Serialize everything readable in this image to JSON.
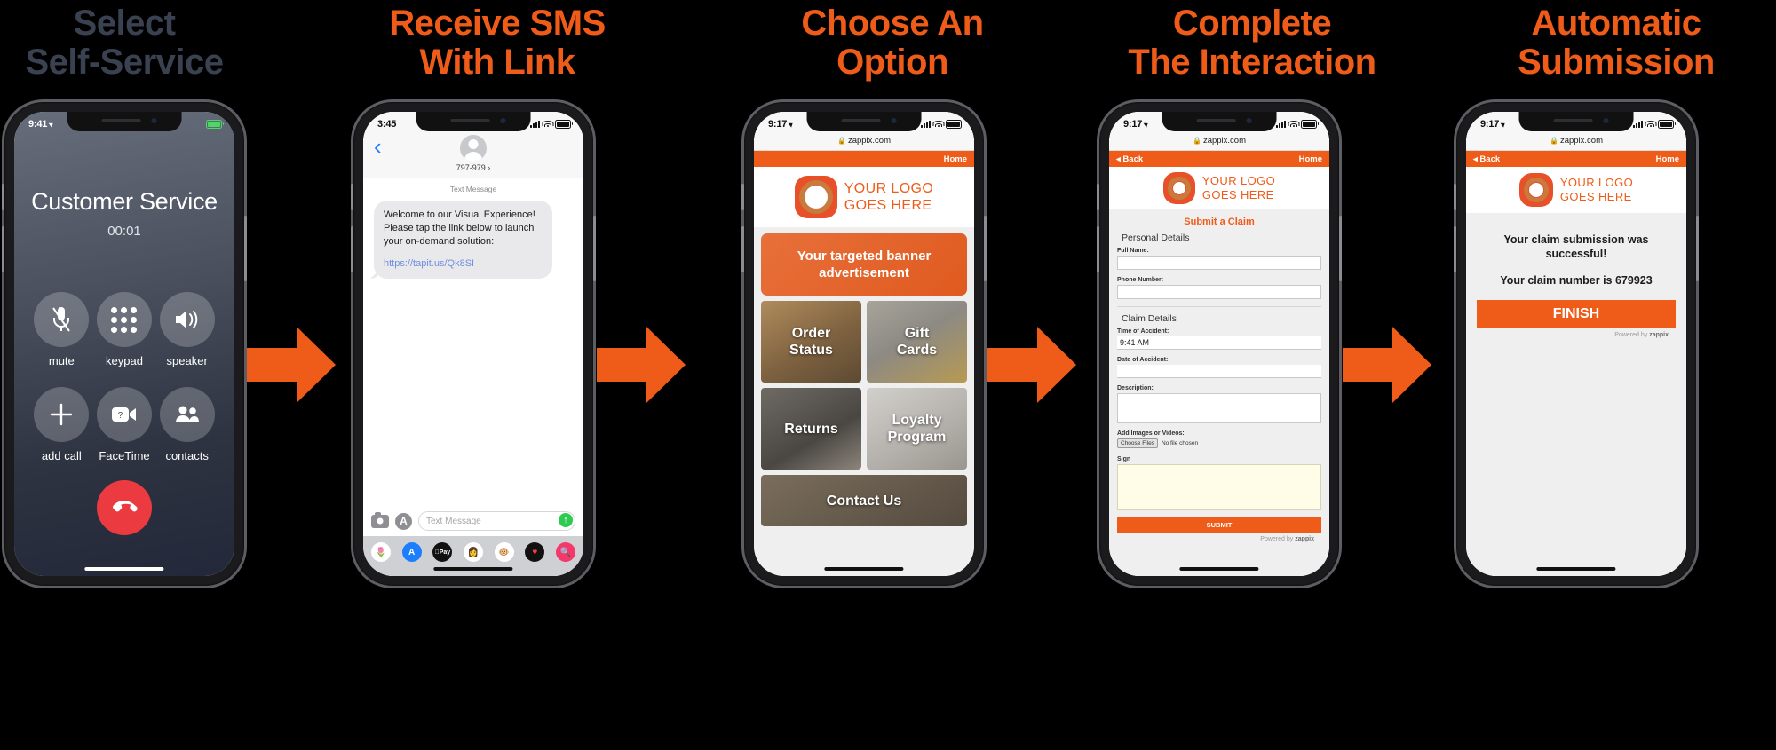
{
  "steps": [
    {
      "title_line1": "Select",
      "title_line2": "Self-Service",
      "color": "#3a4150"
    },
    {
      "title_line1": "Receive SMS",
      "title_line2": "With Link",
      "color": "#ef5c19"
    },
    {
      "title_line1": "Choose An",
      "title_line2": "Option",
      "color": "#ef5c19"
    },
    {
      "title_line1": "Complete",
      "title_line2": "The Interaction",
      "color": "#ef5c19"
    },
    {
      "title_line1": "Automatic",
      "title_line2": "Submission",
      "color": "#ef5c19"
    }
  ],
  "phone_call": {
    "status_time": "9:41",
    "caller_name": "Customer Service",
    "call_duration": "00:01",
    "buttons": [
      {
        "label": "mute",
        "icon": "microphone-muted-icon"
      },
      {
        "label": "keypad",
        "icon": "keypad-icon"
      },
      {
        "label": "speaker",
        "icon": "speaker-icon"
      },
      {
        "label": "add call",
        "icon": "plus-icon"
      },
      {
        "label": "FaceTime",
        "icon": "video-camera-icon"
      },
      {
        "label": "contacts",
        "icon": "contacts-icon"
      }
    ],
    "end_call_icon": "end-call-icon"
  },
  "phone_sms": {
    "status_time": "3:45",
    "contact_number": "797-979",
    "timestamp_label": "Text Message",
    "message_body": "Welcome to our Visual Experience! Please tap the link below to launch your on-demand solution:",
    "message_link": "https://tapit.us/Qk8SI",
    "input_placeholder": "Text Message",
    "send_icon": "send-arrow-icon",
    "dock_apps": [
      "photos-app-icon",
      "app-store-icon",
      "apple-pay-icon",
      "memoji-icon",
      "animoji-icon",
      "music-app-icon",
      "images-search-icon"
    ]
  },
  "phone_menu": {
    "status_time": "9:17",
    "url": "zappix.com",
    "nav_home": "Home",
    "logo_line1": "YOUR LOGO",
    "logo_line2": "GOES HERE",
    "banner_line1": "Your targeted banner",
    "banner_line2": "advertisement",
    "tiles": [
      {
        "line1": "Order",
        "line2": "Status"
      },
      {
        "line1": "Gift",
        "line2": "Cards"
      },
      {
        "line1": "Returns",
        "line2": ""
      },
      {
        "line1": "Loyalty",
        "line2": "Program"
      },
      {
        "line1": "Contact Us",
        "line2": ""
      }
    ]
  },
  "phone_form": {
    "status_time": "9:17",
    "url": "zappix.com",
    "nav_back": "Back",
    "nav_home": "Home",
    "logo_line1": "YOUR LOGO",
    "logo_line2": "GOES HERE",
    "form_title": "Submit a Claim",
    "section_personal": "Personal Details",
    "label_fullname": "Full Name:",
    "value_fullname": "",
    "label_phone": "Phone Number:",
    "value_phone": "",
    "section_claim": "Claim Details",
    "label_time": "Time of Accident:",
    "value_time": "9:41 AM",
    "label_date": "Date of Accident:",
    "value_date": "",
    "label_description": "Description:",
    "value_description": "",
    "label_media": "Add Images or Videos:",
    "file_button": "Choose Files",
    "file_status": "No file chosen",
    "label_sign": "Sign",
    "submit_label": "SUBMIT",
    "powered_by": "Powered by",
    "powered_brand": "zappix"
  },
  "phone_done": {
    "status_time": "9:17",
    "url": "zappix.com",
    "nav_back": "Back",
    "nav_home": "Home",
    "logo_line1": "YOUR LOGO",
    "logo_line2": "GOES HERE",
    "success_line1": "Your claim submission was successful!",
    "success_line2": "Your claim number is 679923",
    "finish_label": "FINISH",
    "powered_by": "Powered by",
    "powered_brand": "zappix"
  },
  "theme": {
    "orange": "#ef5c19",
    "dark_text": "#3a4150",
    "background": "#000000"
  }
}
